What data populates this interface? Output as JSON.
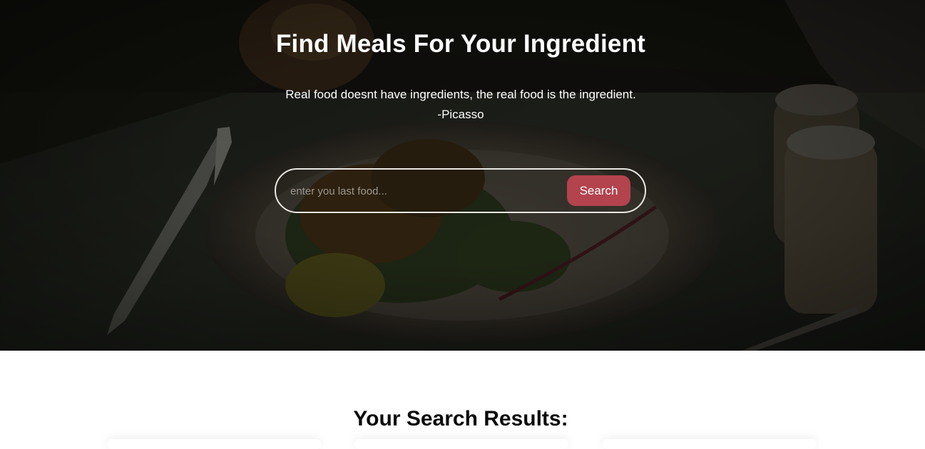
{
  "hero": {
    "title": "Find Meals For Your Ingredient",
    "quote": "Real food doesnt have ingredients, the real food is the ingredient.",
    "quote_author": "-Picasso",
    "background_image": "dark restaurant plate of food with knife and salt shakers"
  },
  "search": {
    "placeholder": "enter you last food...",
    "value": "",
    "button_label": "Search"
  },
  "results": {
    "heading": "Your Search Results:"
  },
  "colors": {
    "accent": "#b3434d",
    "hero_overlay": "#1d1c16",
    "text_light": "#ffffff",
    "text_dark": "#0b0b0b"
  }
}
